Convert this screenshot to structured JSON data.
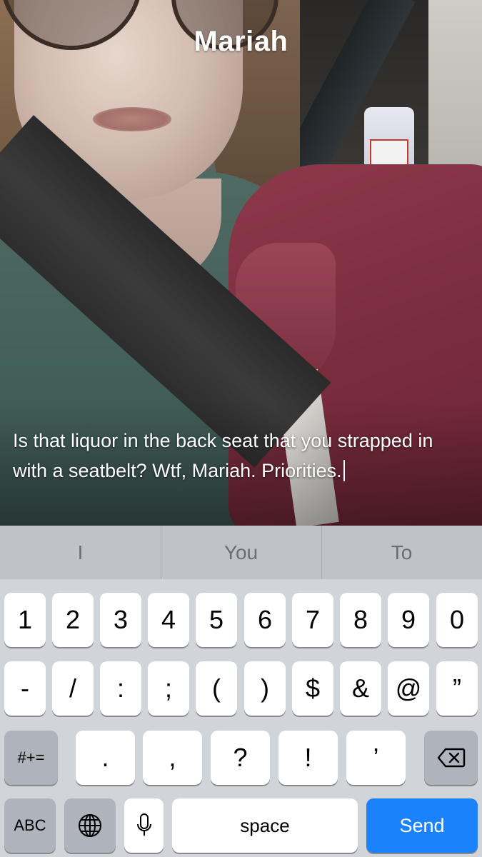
{
  "chat": {
    "contact_name": "Mariah",
    "caption_text": "Is that liquor in the back seat that you strapped in with a seatbelt? Wtf, Mariah. Priorities."
  },
  "keyboard": {
    "suggestions": [
      "I",
      "You",
      "To"
    ],
    "row1": [
      "1",
      "2",
      "3",
      "4",
      "5",
      "6",
      "7",
      "8",
      "9",
      "0"
    ],
    "row2": [
      "-",
      "/",
      ":",
      ";",
      "(",
      ")",
      "$",
      "&",
      "@",
      "”"
    ],
    "row3": {
      "mode_key": "#+=",
      "keys": [
        ".",
        ",",
        "?",
        "!",
        "’"
      ],
      "delete_icon": "backspace-icon"
    },
    "row4": {
      "abc_key": "ABC",
      "globe_icon": "globe-icon",
      "mic_icon": "microphone-icon",
      "space_label": "space",
      "send_label": "Send"
    }
  },
  "colors": {
    "keyboard_bg": "#d1d4d9",
    "suggestion_bar": "#bfc3c8",
    "dark_key": "#aeb3bc",
    "send_blue": "#1a82fb"
  }
}
